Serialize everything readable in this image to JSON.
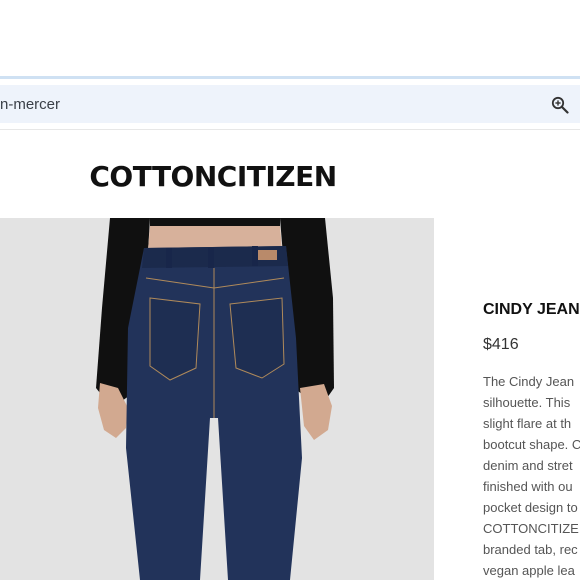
{
  "browser": {
    "url_fragment": "n-mercer",
    "zoom_icon": "zoom-in-icon"
  },
  "brand": {
    "logo_text": "COTTONCITIZEN"
  },
  "product": {
    "title": "CINDY JEAN",
    "price": "$416",
    "description_lines": [
      "The Cindy Jean",
      "silhouette. This",
      "slight flare at th",
      "bootcut shape. C",
      "denim and stret",
      "finished with ou",
      "pocket design to",
      "COTTONCITIZE",
      "branded tab, rec",
      "vegan apple lea"
    ],
    "image_alt": "Model wearing dark indigo flared jeans, back view"
  },
  "colors": {
    "denim": "#22335a",
    "top": "#0f0f10",
    "skin": "#d5ae97",
    "image_bg": "#e3e3e3"
  }
}
